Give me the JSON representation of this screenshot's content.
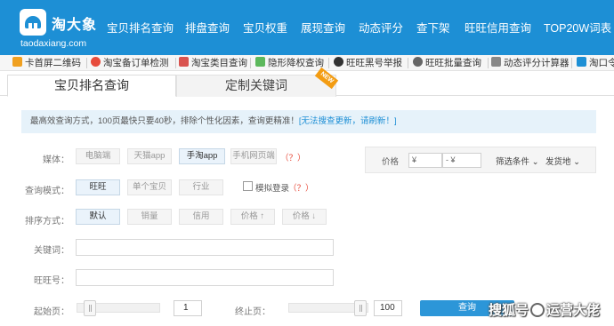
{
  "brand": {
    "name_cn": "淘大象",
    "domain": "taodaxiang.com"
  },
  "nav": [
    "宝贝排名查询",
    "排盘查询",
    "宝贝权重",
    "展现查询",
    "动态评分",
    "查下架",
    "旺旺信用查询",
    "TOP20W词表"
  ],
  "toolbar": [
    {
      "label": "卡首屏二维码",
      "icon": "qrcode-icon",
      "color": "#f0a020"
    },
    {
      "label": "淘宝备订单检测",
      "icon": "alert-icon",
      "color": "#e74c3c"
    },
    {
      "label": "淘宝类目查询",
      "icon": "category-icon",
      "color": "#d9534f"
    },
    {
      "label": "隐形降权查询",
      "icon": "shield-icon",
      "color": "#5cb85c"
    },
    {
      "label": "旺旺黑号举报",
      "icon": "report-icon",
      "color": "#333333"
    },
    {
      "label": "旺旺批量查询",
      "icon": "batch-icon",
      "color": "#666666"
    },
    {
      "label": "动态评分计算器",
      "icon": "calculator-icon",
      "color": "#888888"
    },
    {
      "label": "淘口令",
      "icon": "token-icon",
      "color": "#1d8fd5"
    }
  ],
  "tabs": {
    "active": "宝贝排名查询",
    "second": "定制关键词",
    "badge": "NEW"
  },
  "notice": {
    "text": "最高效查询方式，100页最快只要40秒，排除个性化因素，查询更精准！",
    "link": "[无法搜查更新，请刷新！]"
  },
  "form": {
    "media_label": "媒体：",
    "media_options": [
      "电脑端",
      "天猫app",
      "手淘app",
      "手机网页端"
    ],
    "media_selected": "手淘app",
    "mode_label": "查询模式：",
    "mode_options": [
      "旺旺",
      "单个宝贝",
      "行业"
    ],
    "mode_selected": "旺旺",
    "simulate_login": "模拟登录",
    "help_mark": "（？）",
    "sort_label": "排序方式：",
    "sort_options": [
      "默认",
      "销量",
      "信用",
      "价格 ↑",
      "价格 ↓"
    ],
    "sort_selected": "默认",
    "keyword_label": "关键词：",
    "wangwang_label": "旺旺号：",
    "start_label": "起始页：",
    "start_value": "1",
    "end_label": "终止页：",
    "end_value": "100",
    "search_button": "查询"
  },
  "price_panel": {
    "label": "价格",
    "min_prefix": "¥",
    "max_prefix": "- ¥",
    "filter": "筛选条件 ⌄",
    "ship_from": "发货地 ⌄"
  },
  "watermark": {
    "left": "搜狐号",
    "right": "运营大佬"
  },
  "colors": {
    "brand_blue": "#1d8fd5",
    "button_blue": "#2c96d8",
    "hint_red": "#e74c3c"
  }
}
